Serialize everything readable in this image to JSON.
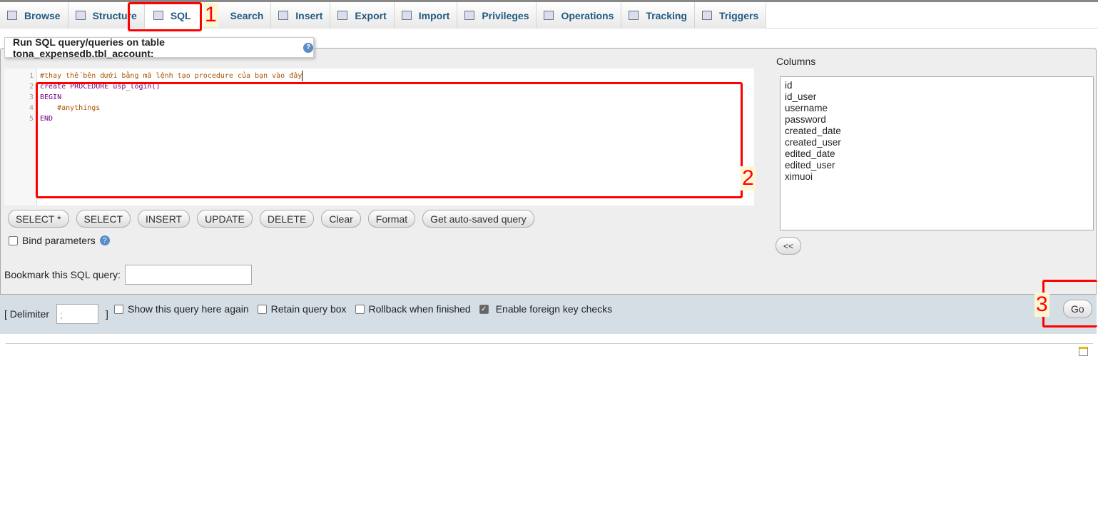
{
  "tabs": [
    {
      "label": "Browse",
      "icon": "browse-icon"
    },
    {
      "label": "Structure",
      "icon": "structure-icon"
    },
    {
      "label": "SQL",
      "icon": "sql-icon",
      "active": true
    },
    {
      "label": "Search",
      "icon": "search-icon"
    },
    {
      "label": "Insert",
      "icon": "insert-icon"
    },
    {
      "label": "Export",
      "icon": "export-icon"
    },
    {
      "label": "Import",
      "icon": "import-icon"
    },
    {
      "label": "Privileges",
      "icon": "privileges-icon"
    },
    {
      "label": "Operations",
      "icon": "operations-icon"
    },
    {
      "label": "Tracking",
      "icon": "tracking-icon"
    },
    {
      "label": "Triggers",
      "icon": "triggers-icon"
    }
  ],
  "legend": "Run SQL query/queries on table tona_expensedb.tbl_account:",
  "editor": {
    "line_numbers": [
      "1",
      "2",
      "3",
      "4",
      "5"
    ],
    "lines": [
      "#thay thế bên dưới bằng mã lệnh tạo procedure của bạn vào đây",
      "create PROCEDURE usp_login()",
      "BEGIN",
      "    #anythings",
      "END"
    ]
  },
  "buttons": [
    "SELECT *",
    "SELECT",
    "INSERT",
    "UPDATE",
    "DELETE",
    "Clear",
    "Format",
    "Get auto-saved query"
  ],
  "bind_parameters": "Bind parameters",
  "bookmark_label": "Bookmark this SQL query:",
  "columns_label": "Columns",
  "columns": [
    "id",
    "id_user",
    "username",
    "password",
    "created_date",
    "created_user",
    "edited_date",
    "edited_user",
    "ximuoi"
  ],
  "insert_button": "<<",
  "footer": {
    "delimiter_label": "[ Delimiter",
    "delimiter_value": ";",
    "delimiter_close": "]",
    "show_query": "Show this query here again",
    "retain": "Retain query box",
    "rollback": "Rollback when finished",
    "fk": "Enable foreign key checks",
    "go": "Go"
  },
  "annotations": [
    "1",
    "2",
    "3"
  ],
  "colors": {
    "annotation": "#ff0000",
    "tab_text": "#235a81",
    "footer_bg": "#d5dde5"
  }
}
